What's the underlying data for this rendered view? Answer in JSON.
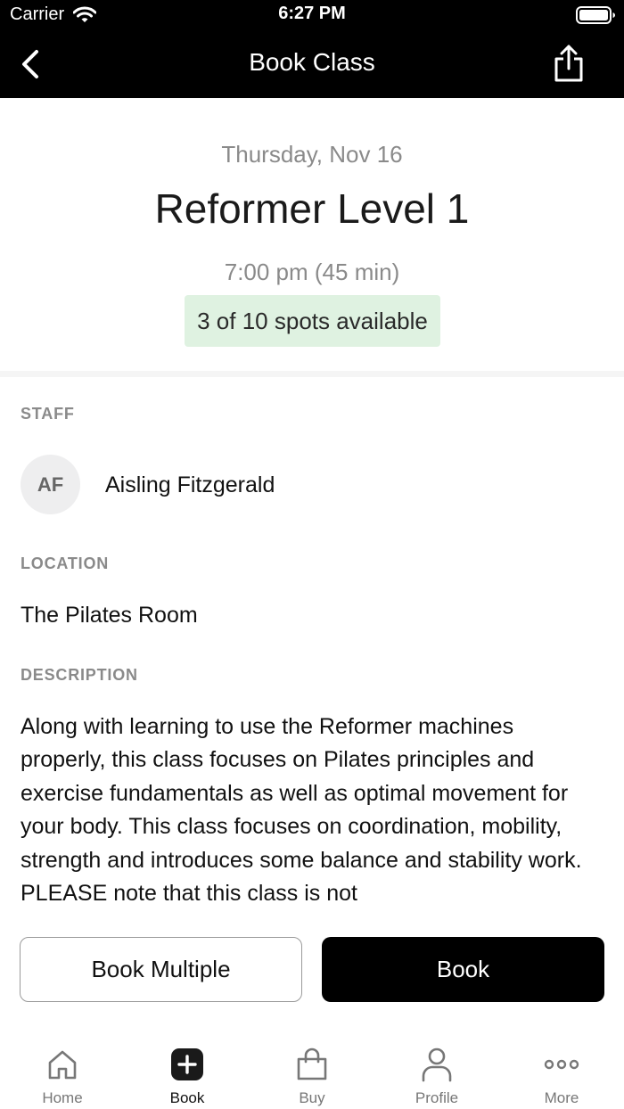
{
  "status_bar": {
    "carrier": "Carrier",
    "time": "6:27 PM"
  },
  "nav": {
    "title": "Book Class"
  },
  "class": {
    "date": "Thursday, Nov 16",
    "name": "Reformer Level 1",
    "time": "7:00 pm (45 min)",
    "spots": "3 of 10 spots available"
  },
  "staff": {
    "label": "STAFF",
    "initials": "AF",
    "name": "Aisling Fitzgerald"
  },
  "location": {
    "label": "LOCATION",
    "name": "The Pilates Room"
  },
  "description": {
    "label": "DESCRIPTION",
    "text": "Along with learning to use the Reformer machines properly, this class focuses on Pilates principles and exercise fundamentals as well as optimal movement for your body. This class focuses on coordination, mobility, strength and introduces some balance and stability work. PLEASE note that this class is not"
  },
  "actions": {
    "book_multiple_label": "Book Multiple",
    "book_label": "Book"
  },
  "tabs": [
    {
      "label": "Home",
      "icon": "home-icon"
    },
    {
      "label": "Book",
      "icon": "plus-square-icon"
    },
    {
      "label": "Buy",
      "icon": "shopping-bag-icon"
    },
    {
      "label": "Profile",
      "icon": "person-icon"
    },
    {
      "label": "More",
      "icon": "more-dots-icon"
    }
  ],
  "colors": {
    "spots_badge_bg": "#dff2e1",
    "header_bg": "#000000",
    "primary_button_bg": "#000000"
  }
}
